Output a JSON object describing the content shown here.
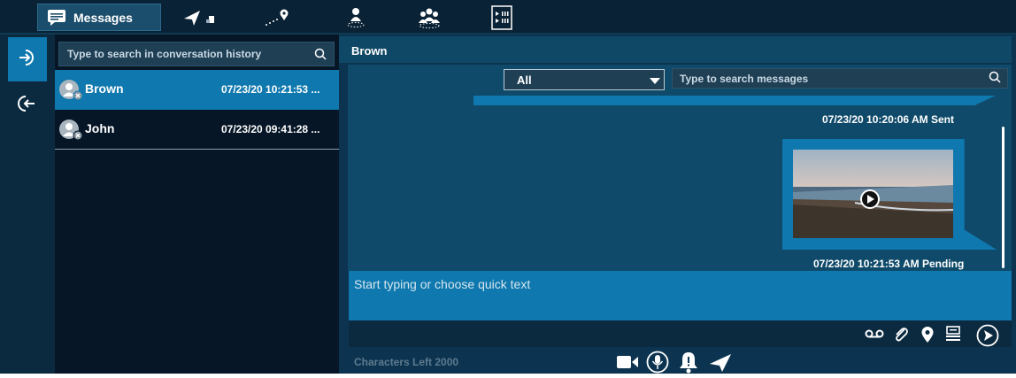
{
  "top_tabs": [
    {
      "label": "Messages",
      "icon": "message-icon",
      "active": true
    },
    {
      "label": "",
      "icon": "navigate-arrow-icon"
    },
    {
      "label": "",
      "icon": "route-pin-icon"
    },
    {
      "label": "",
      "icon": "person-location-icon"
    },
    {
      "label": "",
      "icon": "group-icon"
    },
    {
      "label": "",
      "icon": "video-list-icon"
    }
  ],
  "rail": [
    {
      "icon": "login-icon",
      "active": true
    },
    {
      "icon": "logout-icon",
      "active": false
    }
  ],
  "conversation_search": {
    "placeholder": "Type to search in conversation history"
  },
  "conversations": [
    {
      "name": "Brown",
      "time": "07/23/20 10:21:53 ...",
      "active": true
    },
    {
      "name": "John",
      "time": "07/23/20 09:41:28 ...",
      "active": false
    }
  ],
  "chat": {
    "title": "Brown",
    "filter": {
      "selected": "All"
    },
    "message_search": {
      "placeholder": "Type to search messages"
    },
    "messages": [
      {
        "stamp": "07/23/20 10:20:06 AM Sent",
        "type": "text"
      },
      {
        "stamp": "07/23/20 10:21:53 AM Pending",
        "type": "video"
      }
    ],
    "compose": {
      "placeholder": "Start typing or choose quick text"
    },
    "characters_left": "Characters Left 2000"
  },
  "compose_tools": [
    "voicemail-icon",
    "attachment-icon",
    "location-pin-icon",
    "quick-text-icon",
    "send-icon"
  ],
  "bottom_actions": [
    "video-call-icon",
    "microphone-icon",
    "alert-icon",
    "navigate-icon"
  ],
  "colors": {
    "accent": "#0f78ae",
    "dark": "#061627",
    "panel": "#0c3450"
  }
}
